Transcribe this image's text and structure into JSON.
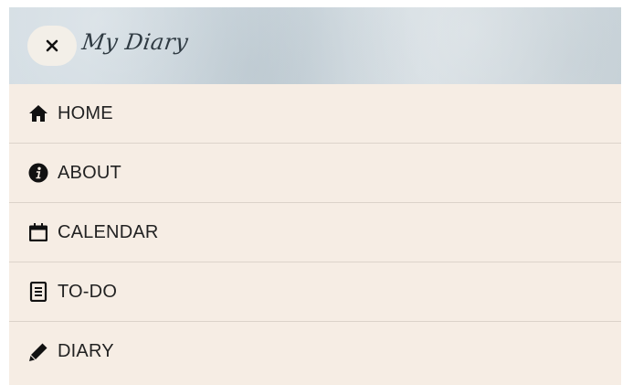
{
  "header": {
    "brand": "My Diary",
    "close_icon": "close-icon"
  },
  "nav": {
    "items": [
      {
        "label": "HOME",
        "icon": "home-icon"
      },
      {
        "label": "ABOUT",
        "icon": "info-icon"
      },
      {
        "label": "CALENDAR",
        "icon": "calendar-icon"
      },
      {
        "label": "TO-DO",
        "icon": "list-icon"
      },
      {
        "label": "DIARY",
        "icon": "pencil-icon"
      }
    ]
  },
  "colors": {
    "menu_background": "#f6ede4",
    "header_background": "#ccd7de",
    "divider": "#dcd3ca",
    "text": "#222222"
  }
}
